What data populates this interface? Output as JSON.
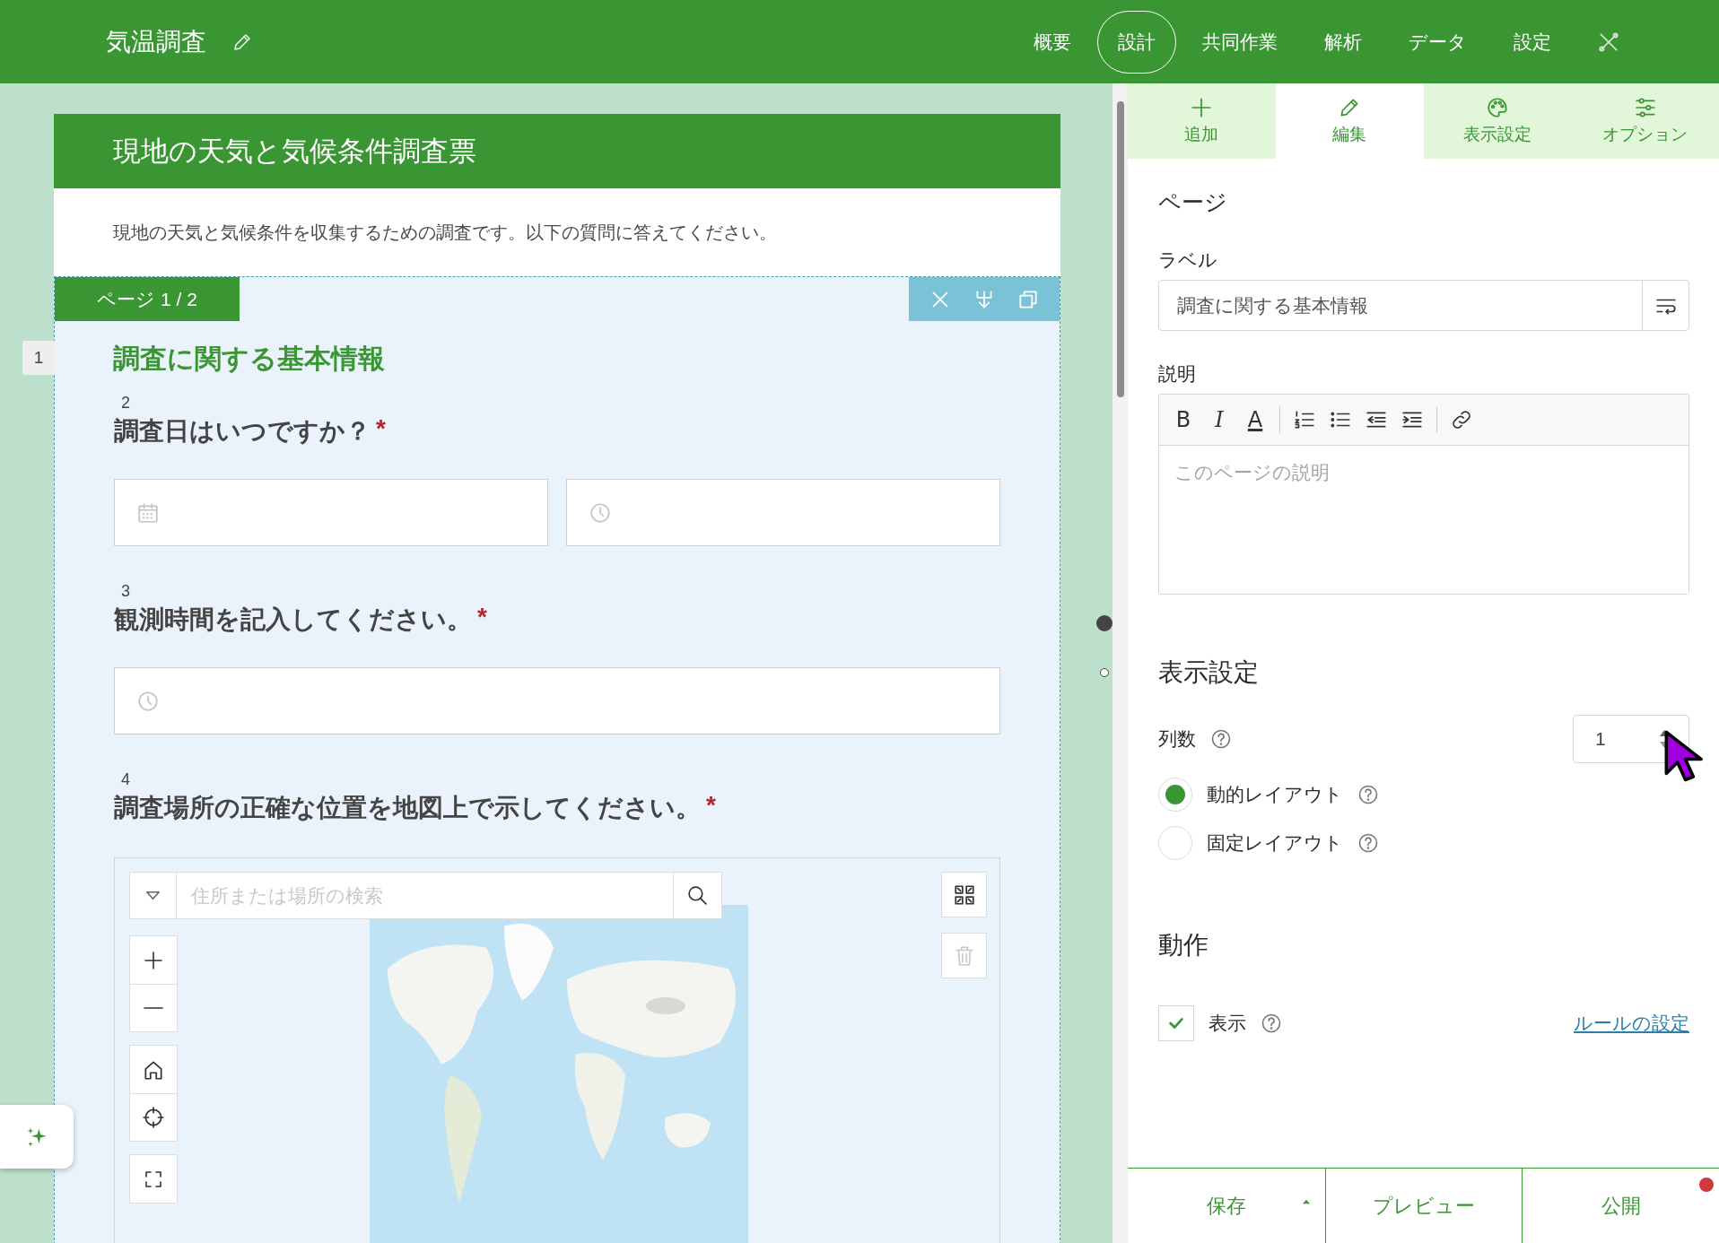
{
  "app": {
    "title": "気温調査"
  },
  "nav": [
    {
      "label": "概要",
      "selected": false
    },
    {
      "label": "設計",
      "selected": true
    },
    {
      "label": "共同作業",
      "selected": false
    },
    {
      "label": "解析",
      "selected": false
    },
    {
      "label": "データ",
      "selected": false
    },
    {
      "label": "設定",
      "selected": false
    }
  ],
  "panel_tabs": [
    {
      "label": "追加",
      "kind": "add",
      "selected": false
    },
    {
      "label": "編集",
      "kind": "edit",
      "selected": true
    },
    {
      "label": "表示設定",
      "kind": "appearance",
      "selected": false
    },
    {
      "label": "オプション",
      "kind": "options",
      "selected": false
    }
  ],
  "form": {
    "title": "現地の天気と気候条件調査票",
    "description": "現地の天気と気候条件を収集するための調査です。以下の質問に答えてください。",
    "page_tag": "ページ 1 / 2",
    "questions": [
      {
        "number": "1",
        "kind": "heading",
        "label": "調査に関する基本情報"
      },
      {
        "number": "2",
        "kind": "datetime",
        "label": "調査日はいつですか？",
        "required_mark": "*"
      },
      {
        "number": "3",
        "kind": "time",
        "label": "観測時間を記入してください。",
        "required_mark": "*"
      },
      {
        "number": "4",
        "kind": "map",
        "label": "調査場所の正確な位置を地図上で示してください。",
        "required_mark": "*",
        "search_placeholder": "住所または場所の検索"
      }
    ]
  },
  "properties": {
    "section": "ページ",
    "label_caption": "ラベル",
    "label_value": "調査に関する基本情報",
    "description_caption": "説明",
    "format_glyphs": [
      "B",
      "I",
      "A"
    ],
    "description_placeholder": "このページの説明",
    "display_heading": "表示設定",
    "columns_caption": "列数",
    "columns_value": "1",
    "layouts": [
      {
        "label": "動的レイアウト",
        "selected": true
      },
      {
        "label": "固定レイアウト",
        "selected": false
      }
    ],
    "behavior_heading": "動作",
    "visible": {
      "label": "表示",
      "checked": true
    },
    "rules_link": "ルールの設定"
  },
  "actions": [
    {
      "label": "保存",
      "kind": "split",
      "notification": false
    },
    {
      "label": "プレビュー",
      "kind": "plain",
      "notification": false
    },
    {
      "label": "公開",
      "kind": "plain",
      "notification": true
    }
  ]
}
